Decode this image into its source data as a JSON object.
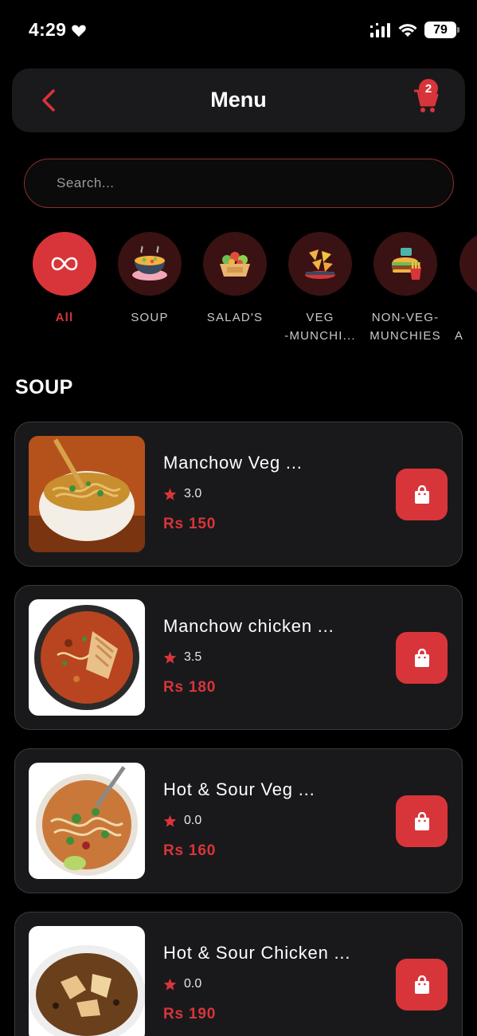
{
  "status_bar": {
    "time": "4:29",
    "battery": "79"
  },
  "header": {
    "title": "Menu",
    "cart_count": "2"
  },
  "search": {
    "placeholder": "Search..."
  },
  "categories": [
    {
      "label": "All",
      "icon": "infinity-icon"
    },
    {
      "label": "SOUP",
      "icon": "soup-bowl-icon"
    },
    {
      "label": "SALAD'S",
      "icon": "salad-bowl-icon"
    },
    {
      "label": "VEG\n-MUNCHI...",
      "icon": "nachos-icon"
    },
    {
      "label": "NON-VEG-\nMUNCHIES",
      "icon": "burger-fries-icon"
    },
    {
      "label": "A",
      "icon": "category-icon"
    }
  ],
  "section": {
    "title": "SOUP"
  },
  "items": [
    {
      "name": "Manchow Veg ...",
      "rating": "3.0",
      "price": "Rs 150"
    },
    {
      "name": "Manchow chicken ...",
      "rating": "3.5",
      "price": "Rs 180"
    },
    {
      "name": "Hot & Sour Veg ...",
      "rating": "0.0",
      "price": "Rs 160"
    },
    {
      "name": "Hot & Sour Chicken ...",
      "rating": "0.0",
      "price": "Rs 190"
    }
  ],
  "colors": {
    "accent": "#d8353a",
    "card_bg": "#19191b",
    "page_bg": "#000000"
  }
}
